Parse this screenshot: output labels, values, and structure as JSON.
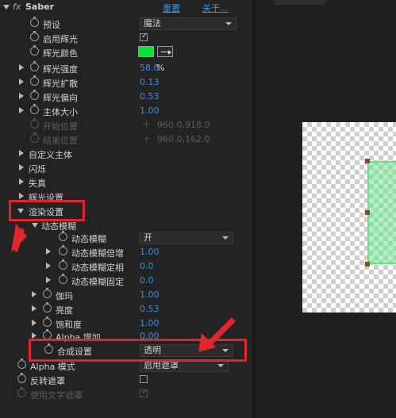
{
  "effect": {
    "fx": "fx",
    "name": "Saber",
    "reset": "重置",
    "about": "关于..."
  },
  "props": {
    "preset": {
      "label": "预设",
      "value": "魔法"
    },
    "enable_glow": {
      "label": "启用辉光",
      "checked": true
    },
    "glow_color": {
      "label": "辉光颜色",
      "color": "#00e832"
    },
    "glow_intensity": {
      "label": "辉光强度",
      "value": "58.0",
      "unit": "%"
    },
    "glow_spread": {
      "label": "辉光扩散",
      "value": "0.13"
    },
    "glow_bias": {
      "label": "辉光偏向",
      "value": "0.53"
    },
    "core_size": {
      "label": "主体大小",
      "value": "1.00"
    },
    "start_pos": {
      "label": "开始位置",
      "value": "960.0,918.0"
    },
    "end_pos": {
      "label": "结束位置",
      "value": "960.0,162.0"
    },
    "custom_core": {
      "label": "自定义主体"
    },
    "flicker": {
      "label": "闪烁"
    },
    "distortion": {
      "label": "失真"
    },
    "glow_settings": {
      "label": "辉光设置"
    },
    "render_settings": {
      "label": "渲染设置"
    },
    "motion_blur": {
      "label": "动态模糊"
    },
    "mb_toggle": {
      "label": "动态模糊",
      "value": "开"
    },
    "mb_multiplier": {
      "label": "动态模糊倍增",
      "value": "1.00"
    },
    "mb_fixed_phase": {
      "label": "动态模糊定相",
      "value": "0.0"
    },
    "mb_fixed": {
      "label": "动态模糊固定",
      "value": "0.0"
    },
    "gamma": {
      "label": "伽玛",
      "value": "1.00"
    },
    "brightness": {
      "label": "亮度",
      "value": "0.53"
    },
    "saturation": {
      "label": "饱和度",
      "value": "1.00"
    },
    "alpha_boost": {
      "label": "Alpha 增加",
      "value": "0.00"
    },
    "composite": {
      "label": "合成设置",
      "value": "透明"
    },
    "alpha_mode": {
      "label": "Alpha 模式",
      "value": "启用遮罩"
    },
    "invert_mask": {
      "label": "反转遮罩",
      "checked": false
    },
    "use_text_alpha": {
      "label": "使用文字遮罩",
      "checked": true
    }
  }
}
